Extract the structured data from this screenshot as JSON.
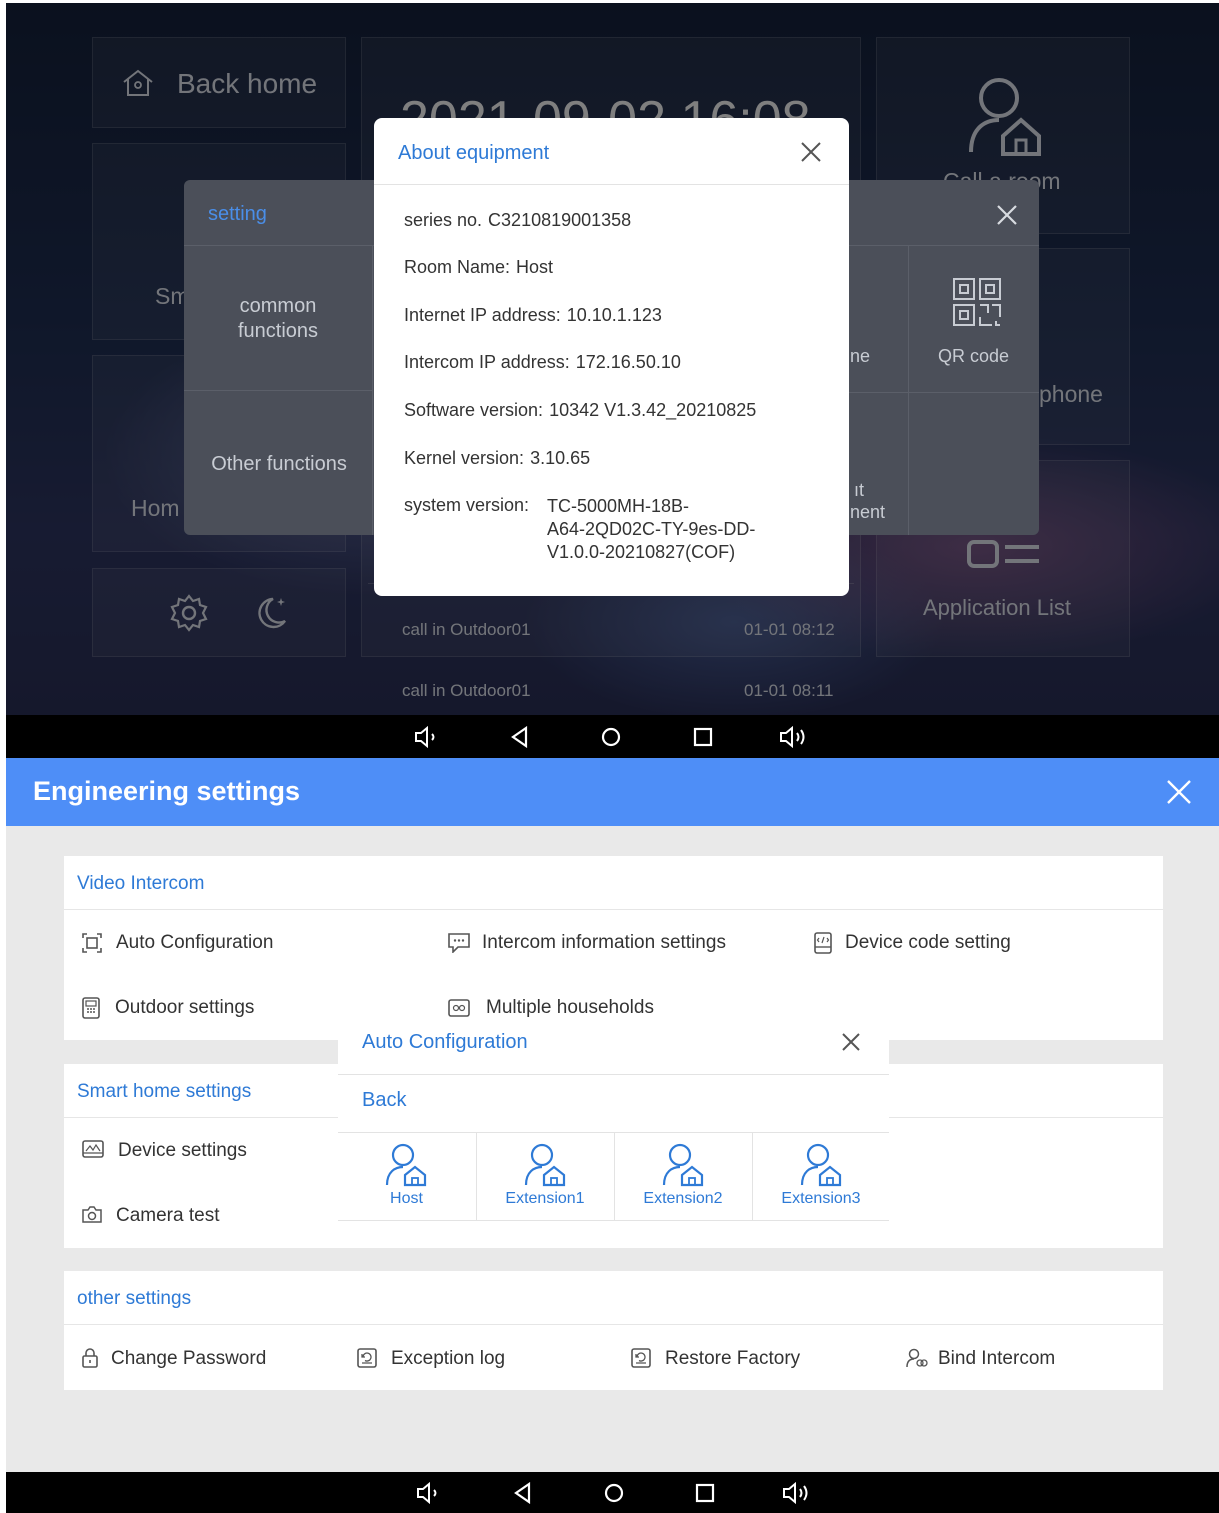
{
  "top_screen": {
    "home_tiles": {
      "back_home": "Back home",
      "datetime": "2021-09-02 16:08",
      "call_room": "Call a room",
      "smart_partial": "Sm",
      "home_partial": "Hom",
      "phone_partial": "phone",
      "app_list": "Application List",
      "call_log": [
        {
          "label": "call in Outdoor01",
          "time": "01-01 08:12"
        },
        {
          "label": "call in Outdoor01",
          "time": "01-01 08:11"
        }
      ]
    },
    "setting_panel": {
      "title": "setting",
      "menu": [
        "common functions",
        "Other functions"
      ],
      "grid": {
        "phone_partial": "ne",
        "qr_code": "QR code",
        "other_partial_1": "ıt",
        "other_partial_2": "nent"
      }
    },
    "about_modal": {
      "title": "About equipment",
      "rows": [
        {
          "label": "series no.",
          "value": "C3210819001358"
        },
        {
          "label": "Room Name:",
          "value": "Host"
        },
        {
          "label": "Internet IP address:",
          "value": "10.10.1.123"
        },
        {
          "label": "Intercom IP address:",
          "value": "172.16.50.10"
        },
        {
          "label": "Software version:",
          "value": "10342 V1.3.42_20210825"
        },
        {
          "label": "Kernel version:",
          "value": "3.10.65"
        }
      ],
      "system_label": "system version:",
      "system_value_lines": [
        "TC-5000MH-18B-",
        "A64-2QD02C-TY-9es-DD-",
        "V1.0.0-20210827(COF)"
      ]
    }
  },
  "bottom_screen": {
    "title": "Engineering settings",
    "sections": {
      "video_intercom": {
        "title": "Video Intercom",
        "items": [
          "Auto Configuration",
          "Intercom information settings",
          "Device code setting",
          "Outdoor settings",
          "Multiple households"
        ]
      },
      "smart_home": {
        "title": "Smart home settings",
        "items": [
          "Device settings",
          "Camera test"
        ]
      },
      "other": {
        "title": "other settings",
        "items": [
          "Change Password",
          "Exception log",
          "Restore Factory",
          "Bind Intercom"
        ]
      }
    },
    "auto_config_dialog": {
      "title": "Auto Configuration",
      "back": "Back",
      "options": [
        "Host",
        "Extension1",
        "Extension2",
        "Extension3"
      ]
    }
  },
  "nav_icons": [
    "volume-down-icon",
    "back-icon",
    "home-icon",
    "recents-icon",
    "volume-up-icon"
  ],
  "colors": {
    "accent": "#2e7ad6",
    "header": "#4e8ef7"
  }
}
